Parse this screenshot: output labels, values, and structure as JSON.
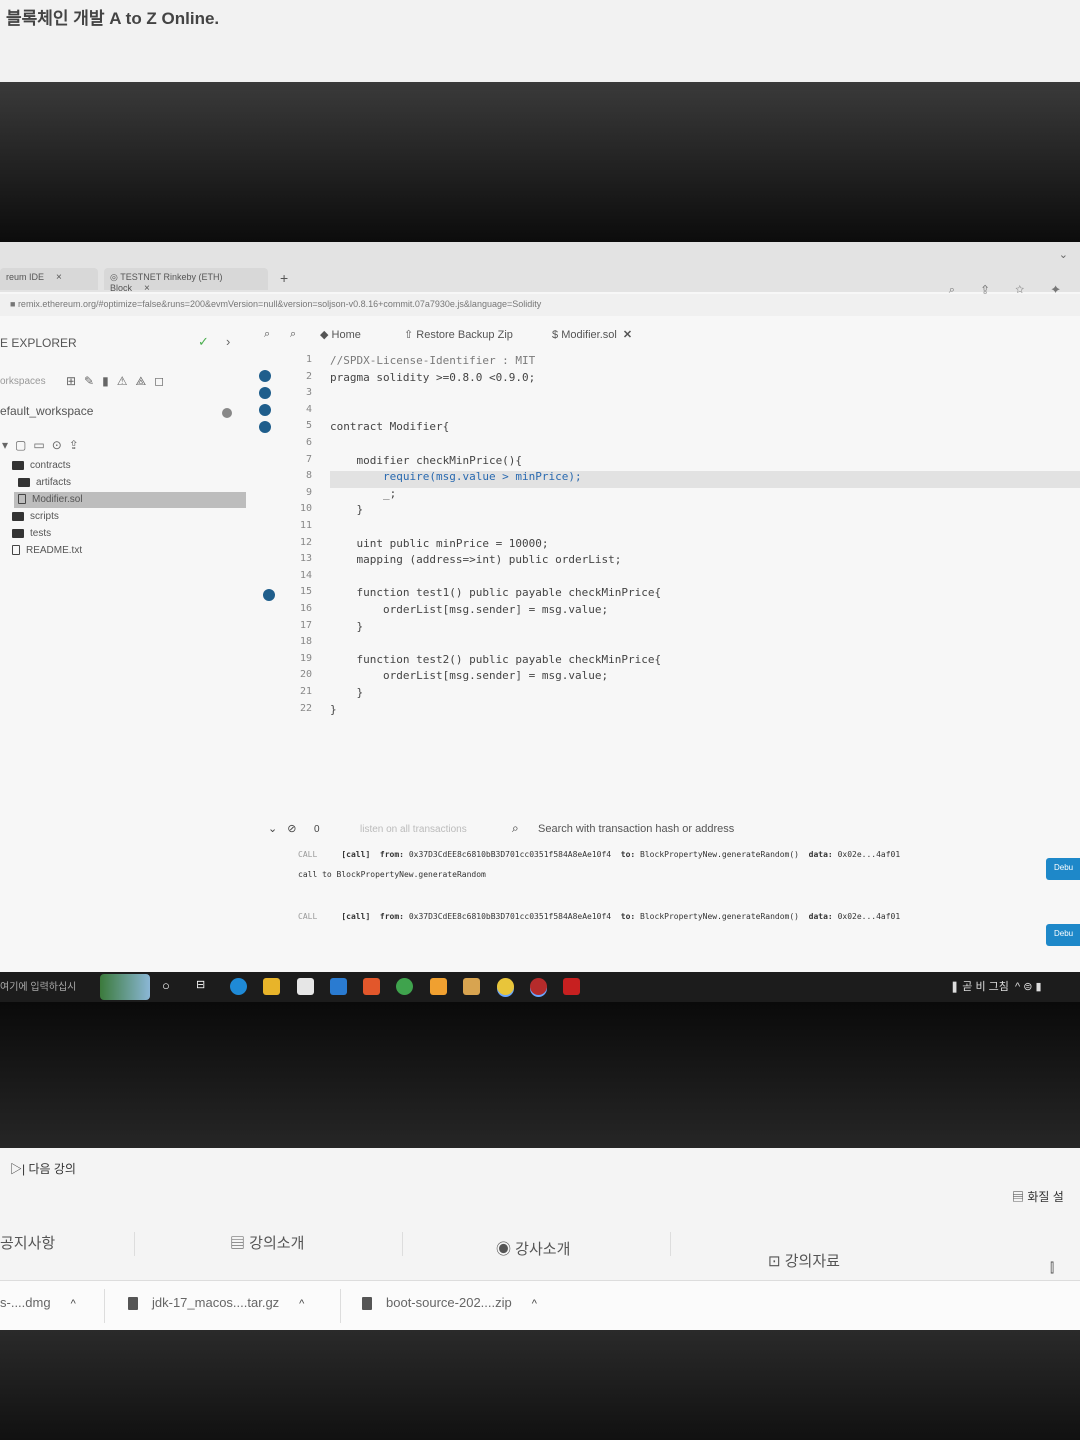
{
  "course": {
    "title": "블록체인 개발 A to Z Online."
  },
  "browser": {
    "tabs": [
      {
        "label": "reum IDE"
      },
      {
        "label": "TESTNET Rinkeby (ETH) Block"
      }
    ],
    "url": "remix.ethereum.org/#optimize=false&runs=200&evmVersion=null&version=soljson-v0.8.16+commit.07a7930e.js&language=Solidity"
  },
  "sidebar": {
    "title": "E EXPLORER",
    "workspaces_label": "orkspaces",
    "workspace_name": "efault_workspace",
    "tree": [
      {
        "label": "contracts",
        "kind": "folder"
      },
      {
        "label": "artifacts",
        "kind": "folder"
      },
      {
        "label": "Modifier.sol",
        "kind": "file"
      },
      {
        "label": "scripts",
        "kind": "folder"
      },
      {
        "label": "tests",
        "kind": "folder"
      },
      {
        "label": "README.txt",
        "kind": "file"
      }
    ]
  },
  "editor": {
    "tabs": [
      {
        "label": "Home"
      },
      {
        "label": "Restore Backup Zip"
      },
      {
        "label": "Modifier.sol"
      }
    ],
    "line_numbers": [
      "1",
      "2",
      "3",
      "4",
      "5",
      "6",
      "7",
      "8",
      "9",
      "10",
      "11",
      "12",
      "13",
      "14",
      "15",
      "16",
      "17",
      "18",
      "19",
      "20",
      "21",
      "22"
    ],
    "code": [
      "//SPDX-License-Identifier : MIT",
      "pragma solidity >=0.8.0 <0.9.0;",
      "",
      "",
      "contract Modifier{",
      "",
      "    modifier checkMinPrice(){",
      "        require(msg.value > minPrice);",
      "        _;",
      "    }",
      "",
      "    uint public minPrice = 10000;",
      "    mapping (address=>int) public orderList;",
      "",
      "    function test1() public payable checkMinPrice{",
      "        orderList[msg.sender] = msg.value;",
      "    }",
      "",
      "    function test2() public payable checkMinPrice{",
      "        orderList[msg.sender] = msg.value;",
      "    }",
      "}"
    ]
  },
  "terminal": {
    "count": "0",
    "listen_label": "listen on all transactions",
    "search_placeholder": "Search with transaction hash or address",
    "logs": [
      {
        "tag": "CALL",
        "call": "[call]",
        "from_label": "from:",
        "from": "0x37D3CdEE8c6810bB3D701cc0351f584A8eAe10f4",
        "to_label": "to:",
        "to": "BlockPropertyNew.generateRandom()",
        "data_label": "data:",
        "data": "0x02e...4af01",
        "detail": "call to BlockPropertyNew.generateRandom"
      },
      {
        "tag": "CALL",
        "call": "[call]",
        "from_label": "from:",
        "from": "0x37D3CdEE8c6810bB3D701cc0351f584A8eAe10f4",
        "to_label": "to:",
        "to": "BlockPropertyNew.generateRandom()",
        "data_label": "data:",
        "data": "0x02e...4af01",
        "detail": ""
      }
    ],
    "debug_label": "Debu"
  },
  "taskbar": {
    "search_text": "여기에 입력하십시",
    "tray_text": "곧 비 그침"
  },
  "course_page": {
    "next_lecture": "다음 강의",
    "settings": "화질 설",
    "nav": [
      {
        "label": "공지사항"
      },
      {
        "label": "강의소개"
      },
      {
        "label": "강사소개"
      },
      {
        "label": "강의자료"
      }
    ]
  },
  "downloads": [
    {
      "label": "s-....dmg"
    },
    {
      "label": "jdk-17_macos....tar.gz"
    },
    {
      "label": "boot-source-202....zip"
    }
  ]
}
